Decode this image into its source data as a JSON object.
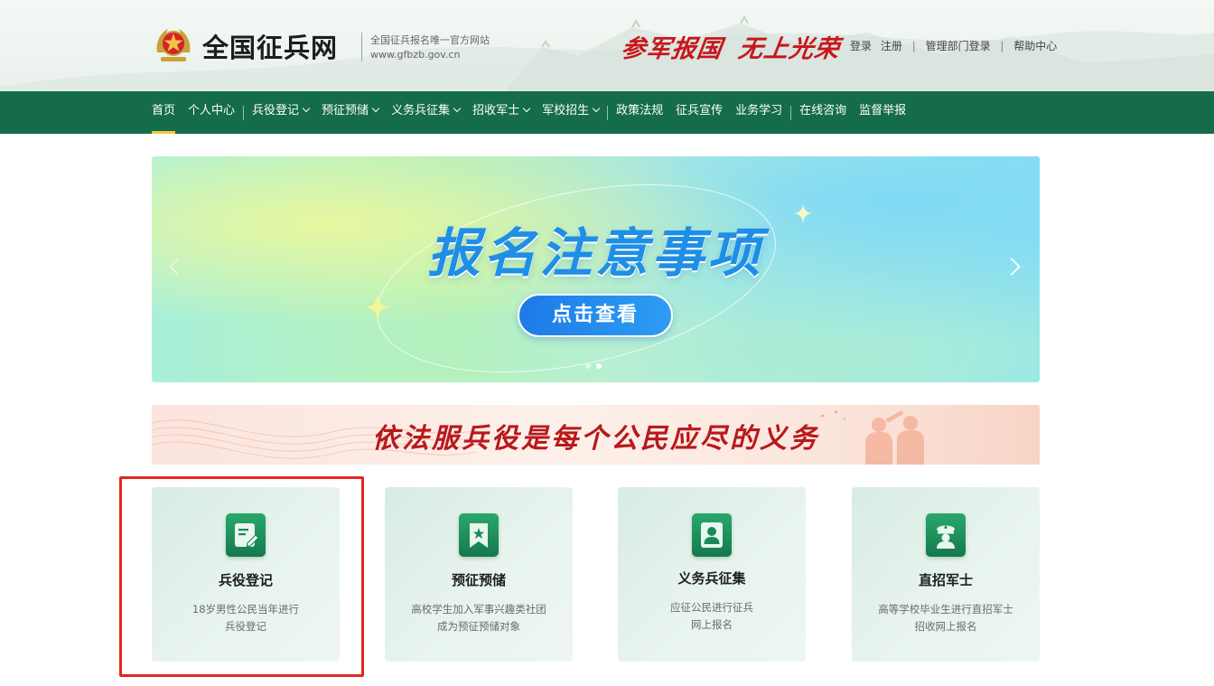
{
  "header": {
    "site_name": "全国征兵网",
    "sub_line1": "全国征兵报名唯一官方网站",
    "sub_line2": "www.gfbzb.gov.cn",
    "slogan_part1": "参军报国",
    "slogan_part2": "无上光荣",
    "links": {
      "login": "登录",
      "register": "注册",
      "admin_login": "管理部门登录",
      "help": "帮助中心"
    }
  },
  "nav": {
    "items": [
      {
        "label": "首页"
      },
      {
        "label": "个人中心"
      },
      {
        "label": "兵役登记"
      },
      {
        "label": "预征预储"
      },
      {
        "label": "义务兵征集"
      },
      {
        "label": "招收军士"
      },
      {
        "label": "军校招生"
      },
      {
        "label": "政策法规"
      },
      {
        "label": "征兵宣传"
      },
      {
        "label": "业务学习"
      },
      {
        "label": "在线咨询"
      },
      {
        "label": "监督举报"
      }
    ]
  },
  "banner": {
    "title": "报名注意事项",
    "button": "点击查看"
  },
  "motto": {
    "text": "依法服兵役是每个公民应尽的义务"
  },
  "cards": [
    {
      "title": "兵役登记",
      "desc1": "18岁男性公民当年进行",
      "desc2": "兵役登记",
      "icon": "edit-document-icon"
    },
    {
      "title": "预征预储",
      "desc1": "高校学生加入军事兴趣类社团",
      "desc2": "成为预征预储对象",
      "icon": "star-bookmark-icon"
    },
    {
      "title": "义务兵征集",
      "desc1": "应征公民进行征兵",
      "desc2": "网上报名",
      "icon": "user-badge-icon"
    },
    {
      "title": "直招军士",
      "desc1": "高等学校毕业生进行直招军士",
      "desc2": "招收网上报名",
      "icon": "soldier-cap-icon"
    }
  ],
  "colors": {
    "nav_bg": "#146c4a",
    "accent_red": "#c8161d",
    "highlight_border": "#e52620",
    "card_icon": "#14794d"
  }
}
